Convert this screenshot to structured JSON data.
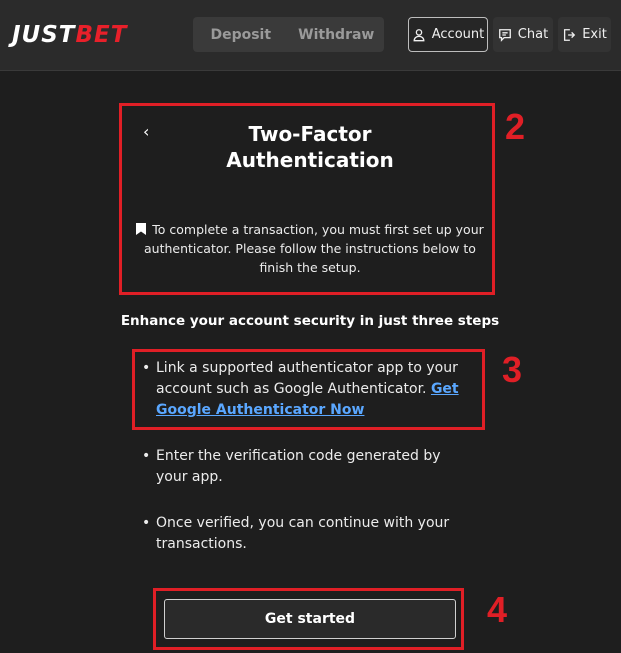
{
  "header": {
    "logo_part1": "JUST",
    "logo_part2": "BET",
    "deposit_label": "Deposit",
    "withdraw_label": "Withdraw",
    "account_label": "Account",
    "chat_label": "Chat",
    "exit_label": "Exit"
  },
  "annotations": {
    "box2": "2",
    "box3": "3",
    "box4": "4"
  },
  "modal": {
    "back_glyph": "‹",
    "title_line1": "Two-Factor",
    "title_line2": "Authentication",
    "notice": "To complete a transaction, you must first set up your authenticator. Please follow the instructions below to finish the setup.",
    "subtitle": "Enhance your account security in just three steps",
    "steps": [
      {
        "text": "Link a supported authenticator app to your account such as Google Authenticator.",
        "link": "Get Google Authenticator Now"
      },
      {
        "text": "Enter the verification code generated by your app."
      },
      {
        "text": "Once verified, you can continue with your transactions."
      }
    ],
    "cta_label": "Get started"
  },
  "colors": {
    "accent_red": "#e01f26",
    "link_blue": "#5aa7ff",
    "background": "#1e1e1e"
  },
  "icons": [
    "user-icon",
    "chat-icon",
    "exit-icon",
    "bookmark-icon",
    "chevron-left-icon"
  ]
}
